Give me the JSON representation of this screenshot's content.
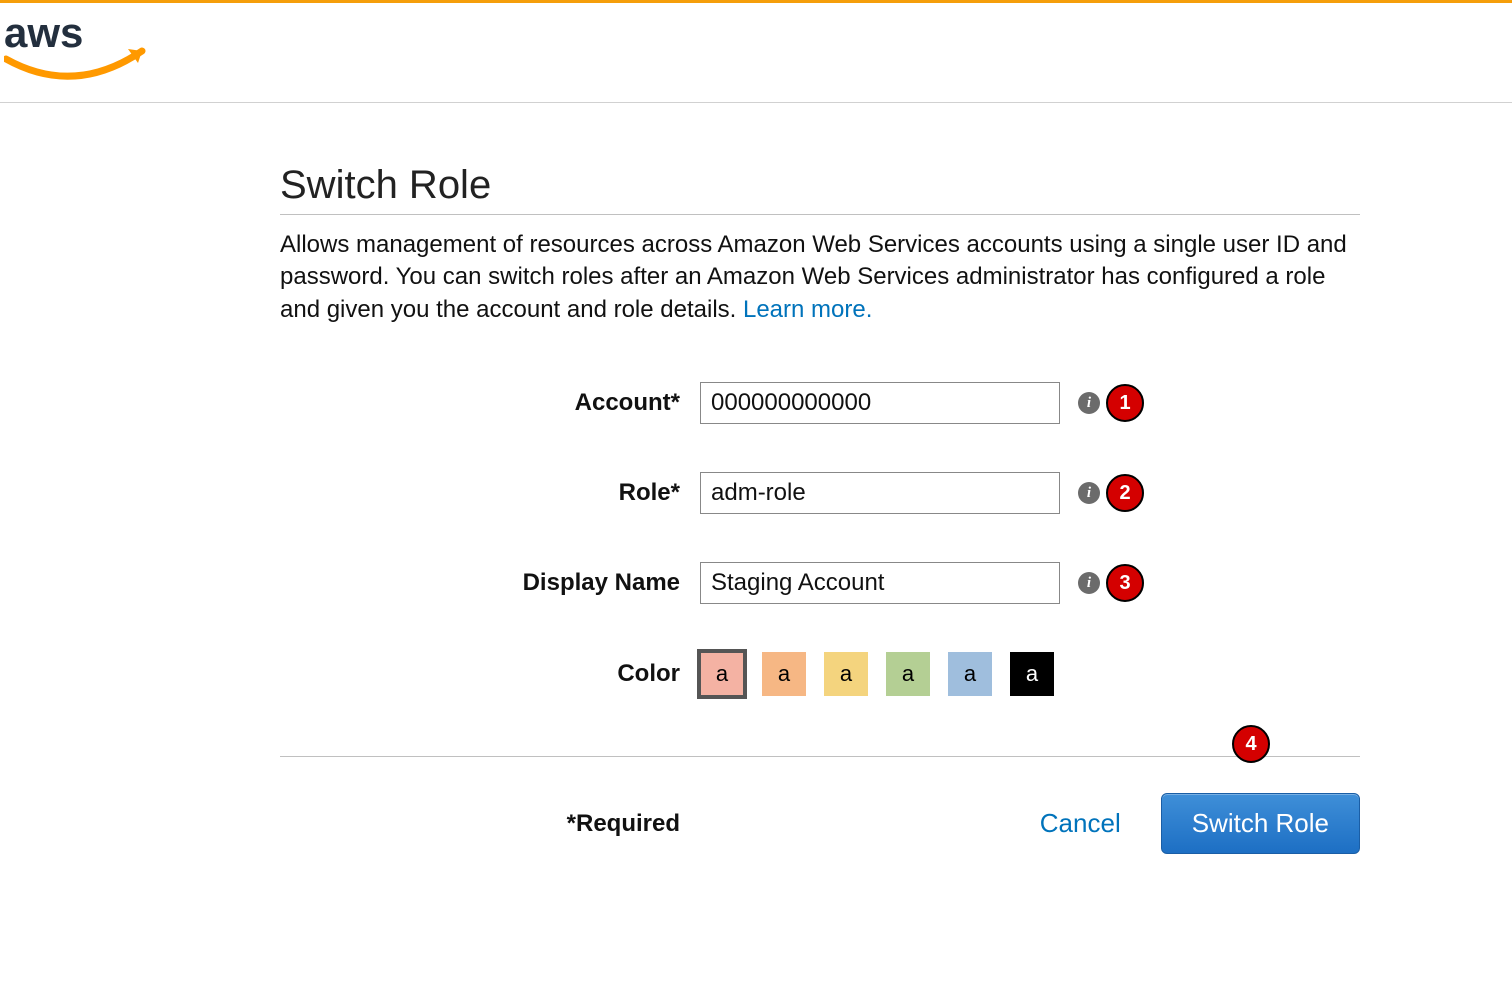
{
  "header": {
    "logo_alt": "aws"
  },
  "page": {
    "title": "Switch Role",
    "description": "Allows management of resources across Amazon Web Services accounts using a single user ID and password. You can switch roles after an Amazon Web Services administrator has configured a role and given you the account and role details. ",
    "learn_more": "Learn more."
  },
  "form": {
    "account": {
      "label": "Account*",
      "value": "000000000000"
    },
    "role": {
      "label": "Role*",
      "value": "adm-role"
    },
    "display_name": {
      "label": "Display Name",
      "value": "Staging Account"
    },
    "color": {
      "label": "Color",
      "swatch_letter": "a",
      "options": [
        {
          "hex": "#f4b2a3",
          "text": "#000",
          "selected": true
        },
        {
          "hex": "#f6b784",
          "text": "#000",
          "selected": false
        },
        {
          "hex": "#f4d47e",
          "text": "#000",
          "selected": false
        },
        {
          "hex": "#b4cf94",
          "text": "#000",
          "selected": false
        },
        {
          "hex": "#9fbedd",
          "text": "#000",
          "selected": false
        },
        {
          "hex": "#000000",
          "text": "#fff",
          "selected": false
        }
      ]
    }
  },
  "footer": {
    "required_note": "*Required",
    "cancel": "Cancel",
    "submit": "Switch Role"
  },
  "annotations": {
    "a1": "1",
    "a2": "2",
    "a3": "3",
    "a4": "4"
  }
}
